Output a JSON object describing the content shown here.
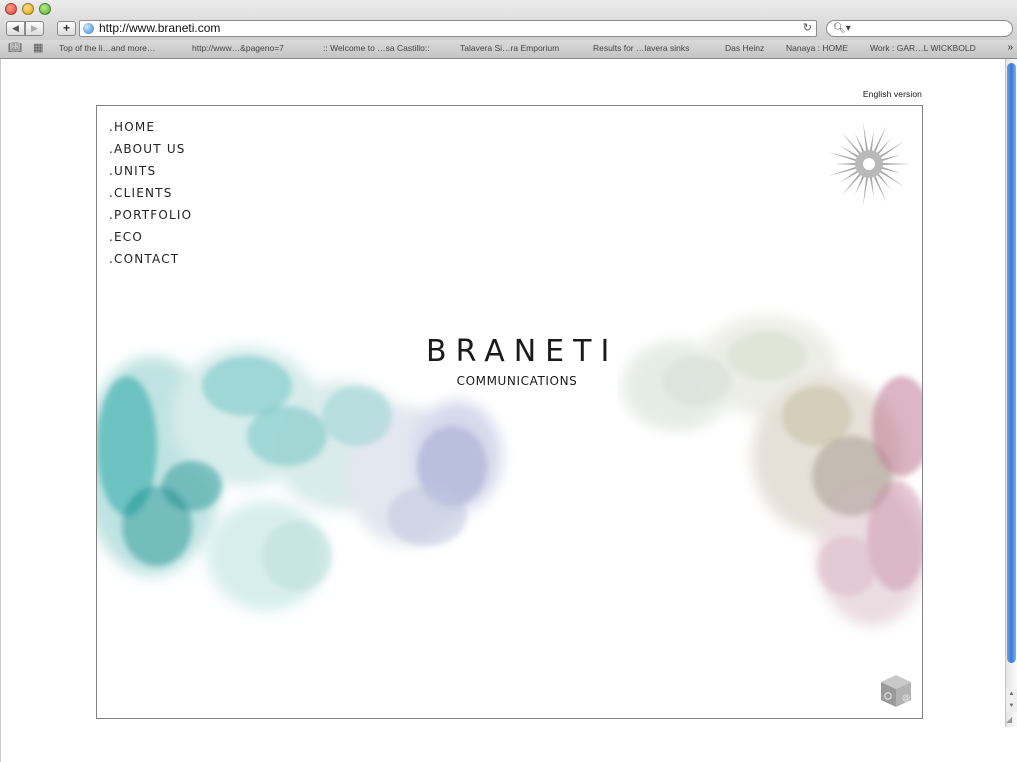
{
  "browser": {
    "url": "http://www.braneti.com",
    "bookmarks": [
      "Top of the li…and more…",
      "http://www…&pageno=7",
      ":: Welcome to …sa Castillo::",
      "Talavera Si…ra Emporium",
      "Results for …lavera sinks",
      "Das Heinz",
      "Nanaya : HOME",
      "Work : GAR…L WICKBOLD"
    ],
    "bookmarks_more": "»"
  },
  "site": {
    "english_link": "English version",
    "nav": [
      ".HOME",
      ".ABOUT US",
      ".UNITS",
      ".CLIENTS",
      ".PORTFOLIO",
      ".ECO",
      ".CONTACT"
    ],
    "brand_name": "BRANETI",
    "brand_sub": "COMMUNICATIONS",
    "icons": {
      "logo": "sunburst-icon",
      "cube": "contact-cube-icon"
    }
  },
  "colors": {
    "smoke_teal": "#2aa7a6",
    "smoke_lavender": "#aab0d6",
    "smoke_rose": "#c07a95",
    "smoke_sand": "#c9c2a8"
  }
}
